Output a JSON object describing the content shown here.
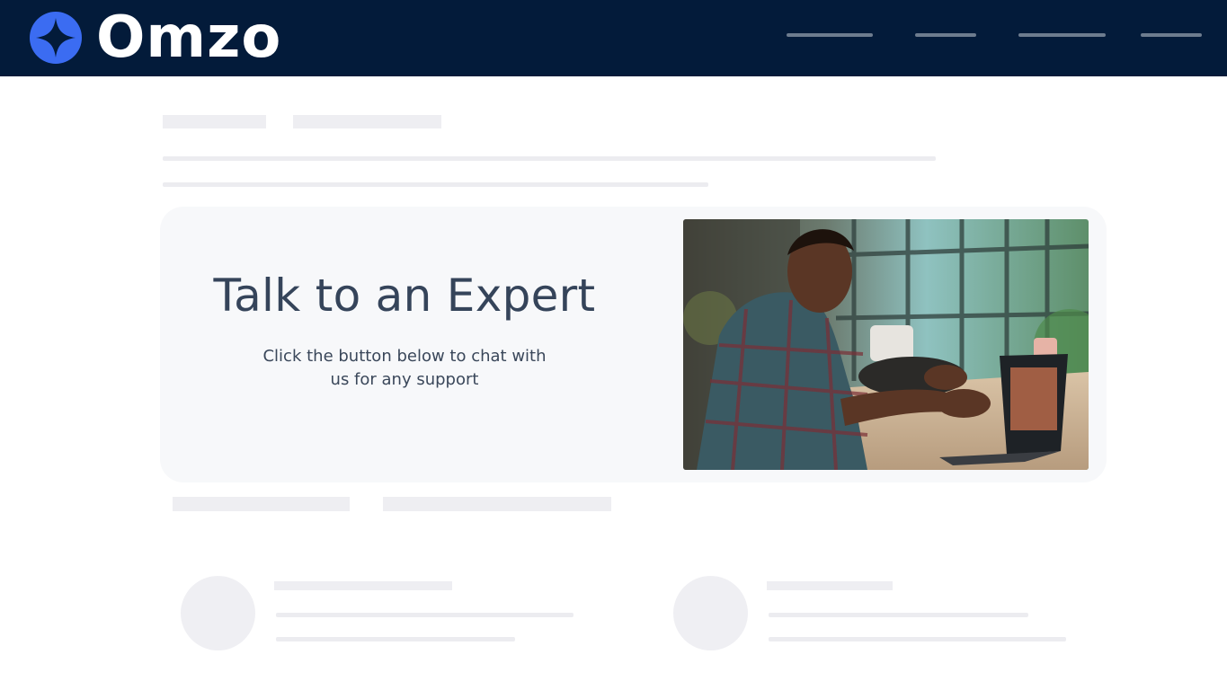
{
  "header": {
    "brand_name": "Omzo",
    "brand_color": "#3b6cf2",
    "background_color": "#031b3a"
  },
  "promo_card": {
    "title": "Talk to an Expert",
    "subtitle": "Click the button below to chat with us for any support",
    "image_icon": "person-on-video-call-image"
  }
}
